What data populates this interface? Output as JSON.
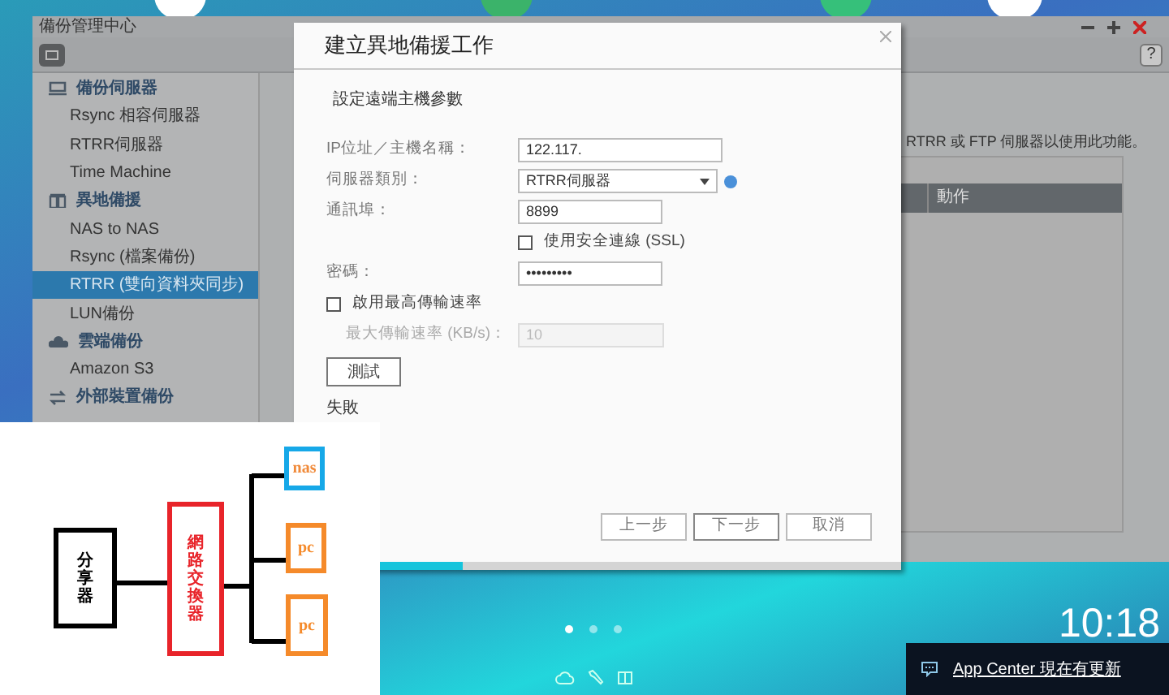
{
  "desktop": {
    "page_dots": [
      {
        "selected": true
      },
      {
        "selected": false
      },
      {
        "selected": false
      }
    ],
    "clock": "10:18",
    "notification": {
      "text": "App Center 現在有更新"
    }
  },
  "backup_window": {
    "title": "備份管理中心",
    "sidebar": [
      {
        "kind": "section",
        "label": "備份伺服器",
        "selected": false
      },
      {
        "kind": "item",
        "label": "Rsync 相容伺服器",
        "selected": false
      },
      {
        "kind": "item",
        "label": "RTRR伺服器",
        "selected": false
      },
      {
        "kind": "item",
        "label": "Time Machine",
        "selected": false
      },
      {
        "kind": "section",
        "label": "異地備援",
        "selected": false
      },
      {
        "kind": "item",
        "label": "NAS to NAS",
        "selected": false
      },
      {
        "kind": "item",
        "label": "Rsync (檔案備份)",
        "selected": false
      },
      {
        "kind": "item",
        "label": "RTRR (雙向資料夾同步)",
        "selected": true
      },
      {
        "kind": "item",
        "label": "LUN備份",
        "selected": false
      },
      {
        "kind": "section",
        "label": "雲端備份",
        "selected": false
      },
      {
        "kind": "item",
        "label": "Amazon S3",
        "selected": false
      },
      {
        "kind": "section",
        "label": "外部裝置備份",
        "selected": false
      }
    ],
    "help_button": "?",
    "hint": "RTRR 或 FTP 伺服器以使用此功能。",
    "table_columns": [
      "動作"
    ]
  },
  "dialog": {
    "title": "建立異地備援工作",
    "subtitle": "設定遠端主機參數",
    "fields": [
      {
        "kind": "text",
        "label": "IP位址／主機名稱：",
        "value": "122.117."
      },
      {
        "kind": "select",
        "label": "伺服器類別：",
        "value": "RTRR伺服器"
      },
      {
        "kind": "text",
        "label": "通訊埠：",
        "value": "8899"
      },
      {
        "kind": "option",
        "label": "使用安全連線 (SSL)",
        "checked": false
      },
      {
        "kind": "password",
        "label": "密碼：",
        "value": "•••••••••"
      },
      {
        "kind": "checkbox",
        "label": "啟用最高傳輸速率",
        "checked": false
      },
      {
        "kind": "text",
        "label": "最大傳輸速率 (KB/s)：",
        "value": "10",
        "disabled": true
      }
    ],
    "test_button": "測試",
    "result": "失敗",
    "buttons": [
      "上一步",
      "下一步",
      "取消"
    ],
    "progress": {
      "level": 0.16
    }
  },
  "diagram": {
    "nodes": [
      {
        "kind": "router",
        "label": "分享器"
      },
      {
        "kind": "switch",
        "label": "網路交換器"
      },
      {
        "kind": "nas",
        "label": "nas"
      },
      {
        "kind": "pc",
        "label": "pc"
      },
      {
        "kind": "pc",
        "label": "pc"
      }
    ]
  }
}
